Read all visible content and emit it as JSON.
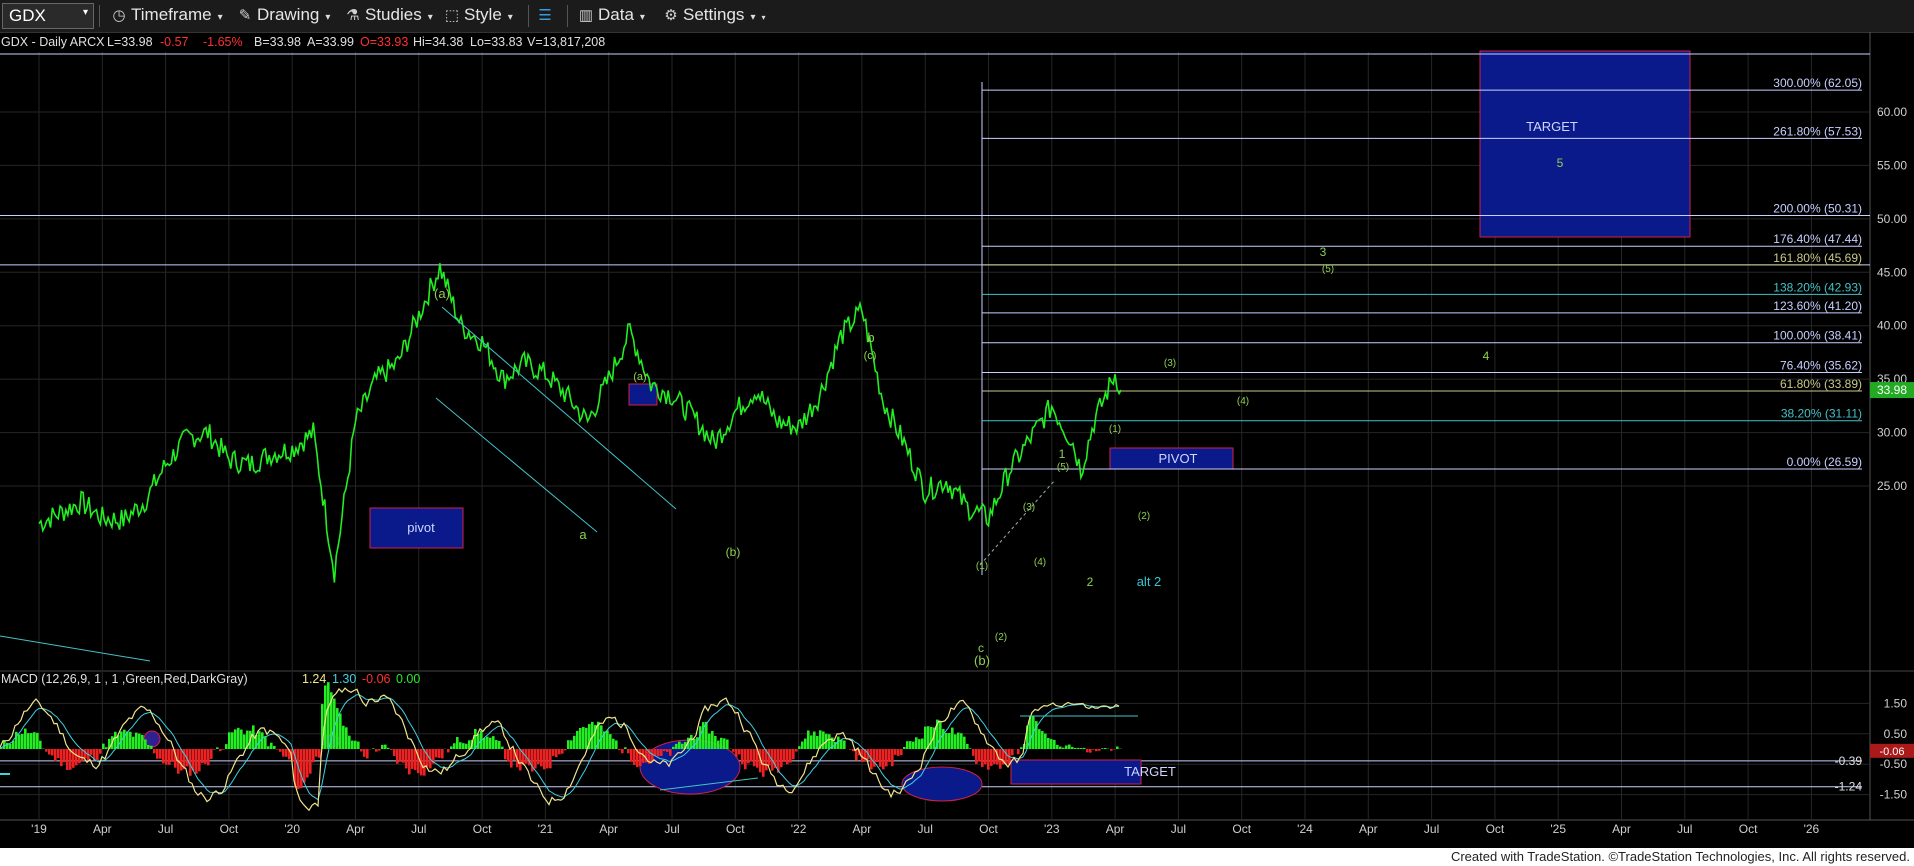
{
  "toolbar": {
    "symbol": "GDX",
    "timeframe": "Timeframe",
    "drawing": "Drawing",
    "studies": "Studies",
    "style": "Style",
    "data": "Data",
    "settings": "Settings"
  },
  "header": {
    "symbol_info": "GDX - Daily  ARCX",
    "last": "L=33.98",
    "chg": "-0.57",
    "pct": "-1.65%",
    "bid": "B=33.98",
    "ask": "A=33.99",
    "open": "O=33.93",
    "hi": "Hi=34.38",
    "lo": "Lo=33.83",
    "vol": "V=13,817,208"
  },
  "macd_header": {
    "label": "MACD (12,26,9, 1 , 1 ,Green,Red,DarkGray)",
    "v1": "1.24",
    "v2": "1.30",
    "v3": "-0.06",
    "v4": "0.00"
  },
  "footer": "Created with TradeStation. ©TradeStation Technologies, Inc. All rights reserved.",
  "colors": {
    "price": "#22ee22",
    "fib_line": "#c8d0ff",
    "box_fill": "#0a1a8a",
    "box_border": "#d0204a",
    "label_green": "#8fd14f",
    "label_cyan": "#33c6cf",
    "last_price_tag": "#22aa22",
    "macd_hist_pos": "#22ee22",
    "macd_hist_neg": "#ee2222",
    "macd_line": "#f0e68c",
    "signal_line": "#40d0e0"
  },
  "chart_data": [
    {
      "type": "line",
      "title": "GDX - Daily",
      "x_axis_ticks": [
        "'19",
        "Apr",
        "Jul",
        "Oct",
        "'20",
        "Apr",
        "Jul",
        "Oct",
        "'21",
        "Apr",
        "Jul",
        "Oct",
        "'22",
        "Apr",
        "Jul",
        "Oct",
        "'23",
        "Apr",
        "Jul",
        "Oct",
        "'24",
        "Apr",
        "Jul",
        "Oct",
        "'25",
        "Apr",
        "Jul",
        "Oct",
        "'26"
      ],
      "y_axis_ticks": [
        "25.00",
        "30.00",
        "35.00",
        "40.00",
        "45.00",
        "50.00",
        "55.00",
        "60.00"
      ],
      "ylim": [
        21.5,
        65
      ],
      "last_price": "33.98",
      "price_path": [
        [
          "Jan 2019",
          21.5
        ],
        [
          "Feb 2019",
          22.5
        ],
        [
          "Mar 2019",
          23.5
        ],
        [
          "Apr 2019",
          22
        ],
        [
          "May 2019",
          21.8
        ],
        [
          "Jun 2019",
          23.5
        ],
        [
          "Jul 2019",
          27
        ],
        [
          "Aug 2019",
          29.5
        ],
        [
          "Sep 2019",
          30
        ],
        [
          "Oct 2019",
          27.5
        ],
        [
          "Nov 2019",
          27
        ],
        [
          "Dec 2019",
          28
        ],
        [
          "Jan 2020",
          28.5
        ],
        [
          "Feb 2020",
          30
        ],
        [
          "Mar 2020",
          17
        ],
        [
          "Apr 2020",
          31
        ],
        [
          "May 2020",
          35
        ],
        [
          "Jun 2020",
          36.5
        ],
        [
          "Jul 2020",
          41
        ],
        [
          "Aug 2020",
          45.5
        ],
        [
          "Sep 2020",
          40
        ],
        [
          "Oct 2020",
          38.5
        ],
        [
          "Nov 2020",
          35
        ],
        [
          "Dec 2020",
          36.5
        ],
        [
          "Jan 2021",
          35.5
        ],
        [
          "Feb 2021",
          33.5
        ],
        [
          "Mar 2021",
          31
        ],
        [
          "Apr 2021",
          35
        ],
        [
          "May 2021",
          39.5
        ],
        [
          "Jun 2021",
          34.5
        ],
        [
          "Jul 2021",
          33.5
        ],
        [
          "Aug 2021",
          31.5
        ],
        [
          "Sep 2021",
          29
        ],
        [
          "Oct 2021",
          32
        ],
        [
          "Nov 2021",
          34
        ],
        [
          "Dec 2021",
          31
        ],
        [
          "Jan 2022",
          30.5
        ],
        [
          "Feb 2022",
          33.5
        ],
        [
          "Mar 2022",
          39
        ],
        [
          "Apr 2022",
          41.5
        ],
        [
          "May 2022",
          33
        ],
        [
          "Jun 2022",
          29
        ],
        [
          "Jul 2022",
          24.5
        ],
        [
          "Aug 2022",
          25.5
        ],
        [
          "Sep 2022",
          23
        ],
        [
          "Oct 2022",
          22
        ],
        [
          "Nov 2022",
          26.5
        ],
        [
          "Dec 2022",
          29.5
        ],
        [
          "Jan 2023",
          32.5
        ],
        [
          "Feb 2023",
          29
        ],
        [
          "Feb 2023",
          26.5
        ],
        [
          "Mar 2023",
          31
        ],
        [
          "Apr 2023",
          35.5
        ],
        [
          "Apr 2023",
          33.98
        ]
      ],
      "fib_levels": [
        {
          "label": "300.00% (62.05)",
          "value": 62.05
        },
        {
          "label": "261.80% (57.53)",
          "value": 57.53
        },
        {
          "label": "200.00% (50.31)",
          "value": 50.31
        },
        {
          "label": "176.40% (47.44)",
          "value": 47.44
        },
        {
          "label": "161.80% (45.69)",
          "value": 45.69
        },
        {
          "label": "138.20% (42.93)",
          "value": 42.93
        },
        {
          "label": "123.60% (41.20)",
          "value": 41.2
        },
        {
          "label": "100.00% (38.41)",
          "value": 38.41
        },
        {
          "label": "76.40% (35.62)",
          "value": 35.62
        },
        {
          "label": "61.80% (33.89)",
          "value": 33.89
        },
        {
          "label": "38.20% (31.11)",
          "value": 31.11
        },
        {
          "label": "0.00% (26.59)",
          "value": 26.59
        }
      ],
      "boxes": [
        {
          "label": "TARGET",
          "sub": "5"
        },
        {
          "label": "PIVOT"
        },
        {
          "label": "pivot"
        }
      ],
      "wave_labels": [
        "(a)",
        "(a)",
        "a",
        "(b)",
        "b",
        "(c)",
        "c",
        "(b)",
        "(1)",
        "(2)",
        "(3)",
        "(4)",
        "(5)",
        "1",
        "2",
        "alt 2",
        "(1)",
        "(2)",
        "(3)",
        "(4)",
        "(5)",
        "3",
        "4",
        "5"
      ]
    },
    {
      "type": "line",
      "title": "MACD (12,26,9, 1 , 1 ,Green,Red,DarkGray)",
      "y_axis_ticks": [
        "1.50",
        "0.50",
        "-0.50",
        "-1.50"
      ],
      "tags": [
        "-0.39",
        "-1.24"
      ],
      "boxes": [
        {
          "label": "TARGET"
        }
      ]
    }
  ]
}
